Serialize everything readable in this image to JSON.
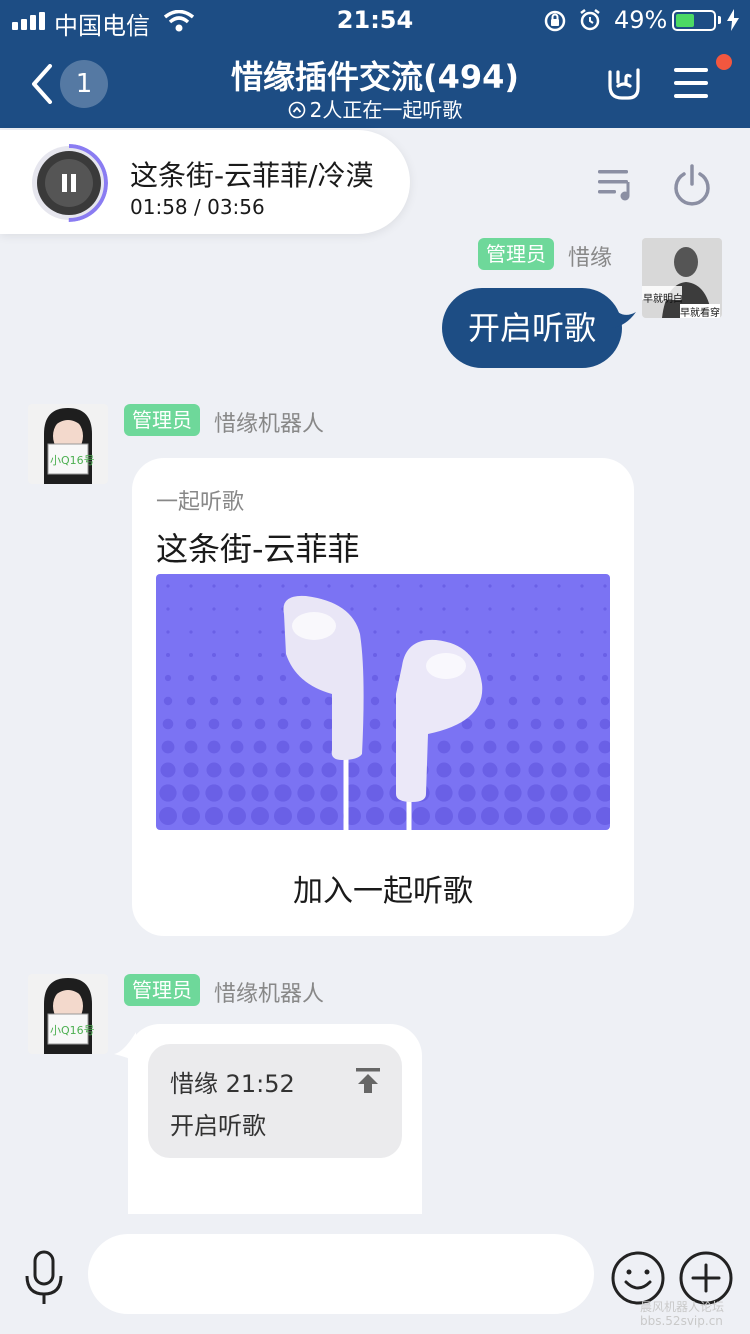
{
  "status_bar": {
    "carrier": "中国电信",
    "time": "21:54",
    "battery_text": "49%",
    "battery_level": 0.49
  },
  "header": {
    "back_count": "1",
    "title": "惜缘插件交流(494)",
    "subtitle": "2人正在一起听歌"
  },
  "music": {
    "song": "这条街-云菲菲/冷漠",
    "time": "01:58 / 03:56",
    "progress": 0.5
  },
  "messages": [
    {
      "role_tag": "管理员",
      "sender": "惜缘",
      "avatar_caption": [
        "早就明白",
        "早就看穿"
      ],
      "text": "开启听歌"
    },
    {
      "role_tag": "管理员",
      "sender": "惜缘机器人",
      "avatar_caption": "小Q16号",
      "card": {
        "kicker": "一起听歌",
        "title": "这条街-云菲菲",
        "action": "加入一起听歌"
      }
    },
    {
      "role_tag": "管理员",
      "sender": "惜缘机器人",
      "avatar_caption": "小Q16号",
      "quote": {
        "header": "惜缘 21:52",
        "body": "开启听歌"
      }
    }
  ],
  "watermark": {
    "line1": "晨风机器人论坛",
    "line2": "bbs.52svip.cn"
  },
  "colors": {
    "header_bg": "#1d4d84",
    "admin_tag": "#6ed89a",
    "card_image_bg": "#7b73f3",
    "notification_dot": "#f2573f"
  }
}
